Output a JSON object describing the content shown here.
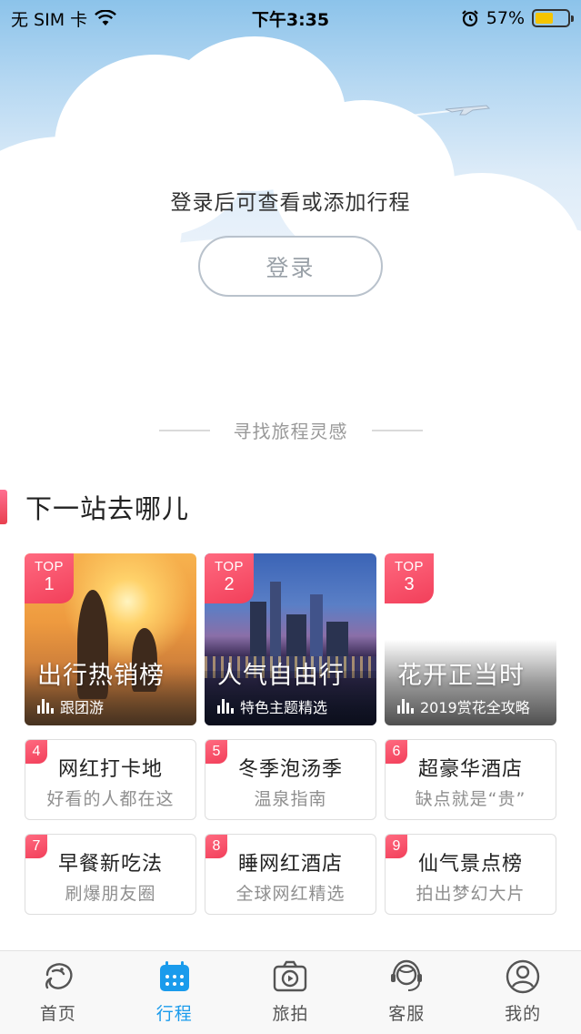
{
  "status_bar": {
    "carrier": "无 SIM 卡",
    "time": "下午3:35",
    "battery_percent": "57%",
    "battery_level": 0.57
  },
  "hero": {
    "message": "登录后可查看或添加行程",
    "login_label": "登录"
  },
  "inspiration": {
    "divider_title": "寻找旅程灵感",
    "section_title": "下一站去哪儿"
  },
  "top_cards": [
    {
      "badge_top": "TOP",
      "badge_num": "1",
      "title": "出行热销榜",
      "subtitle": "跟团游"
    },
    {
      "badge_top": "TOP",
      "badge_num": "2",
      "title": "人气自由行",
      "subtitle": "特色主题精选"
    },
    {
      "badge_top": "TOP",
      "badge_num": "3",
      "title": "花开正当时",
      "subtitle": "2019赏花全攻略"
    }
  ],
  "list_cards": [
    {
      "num": "4",
      "title": "网红打卡地",
      "subtitle": "好看的人都在这"
    },
    {
      "num": "5",
      "title": "冬季泡汤季",
      "subtitle": "温泉指南"
    },
    {
      "num": "6",
      "title": "超豪华酒店",
      "subtitle": "缺点就是“贵”"
    },
    {
      "num": "7",
      "title": "早餐新吃法",
      "subtitle": "刷爆朋友圈"
    },
    {
      "num": "8",
      "title": "睡网红酒店",
      "subtitle": "全球网红精选"
    },
    {
      "num": "9",
      "title": "仙气景点榜",
      "subtitle": "拍出梦幻大片"
    }
  ],
  "tabbar": {
    "active_color": "#1a9bec",
    "items": [
      {
        "label": "首页",
        "icon": "dolphin-home-icon"
      },
      {
        "label": "行程",
        "icon": "calendar-icon",
        "active": true
      },
      {
        "label": "旅拍",
        "icon": "camera-play-icon"
      },
      {
        "label": "客服",
        "icon": "headset-icon"
      },
      {
        "label": "我的",
        "icon": "user-icon"
      }
    ]
  }
}
